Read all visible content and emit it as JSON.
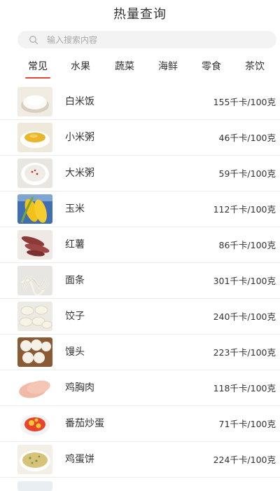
{
  "header": {
    "title": "热量查询"
  },
  "search": {
    "placeholder": "输入搜索内容"
  },
  "tabs": [
    {
      "label": "常见",
      "active": true
    },
    {
      "label": "水果",
      "active": false
    },
    {
      "label": "蔬菜",
      "active": false
    },
    {
      "label": "海鲜",
      "active": false
    },
    {
      "label": "零食",
      "active": false
    },
    {
      "label": "茶饮",
      "active": false
    }
  ],
  "foods": [
    {
      "name": "白米饭",
      "calories": "155千卡/100克",
      "icon": "rice-photo"
    },
    {
      "name": "小米粥",
      "calories": "46千卡/100克",
      "icon": "millet-porridge-photo"
    },
    {
      "name": "大米粥",
      "calories": "59千卡/100克",
      "icon": "rice-porridge-photo"
    },
    {
      "name": "玉米",
      "calories": "112千卡/100克",
      "icon": "corn-photo"
    },
    {
      "name": "红薯",
      "calories": "86千卡/100克",
      "icon": "sweet-potato-photo"
    },
    {
      "name": "面条",
      "calories": "301千卡/100克",
      "icon": "noodles-photo"
    },
    {
      "name": "饺子",
      "calories": "240千卡/100克",
      "icon": "dumplings-photo"
    },
    {
      "name": "馒头",
      "calories": "223千卡/100克",
      "icon": "steamed-bun-photo"
    },
    {
      "name": "鸡胸肉",
      "calories": "118千卡/100克",
      "icon": "chicken-breast-photo"
    },
    {
      "name": "番茄炒蛋",
      "calories": "71千卡/100克",
      "icon": "tomato-egg-photo"
    },
    {
      "name": "鸡蛋饼",
      "calories": "224千卡/100克",
      "icon": "egg-pancake-photo"
    }
  ],
  "colors": {
    "accent": "#e6453a",
    "divider": "#ededed",
    "search_bg": "#f3f3f3"
  }
}
